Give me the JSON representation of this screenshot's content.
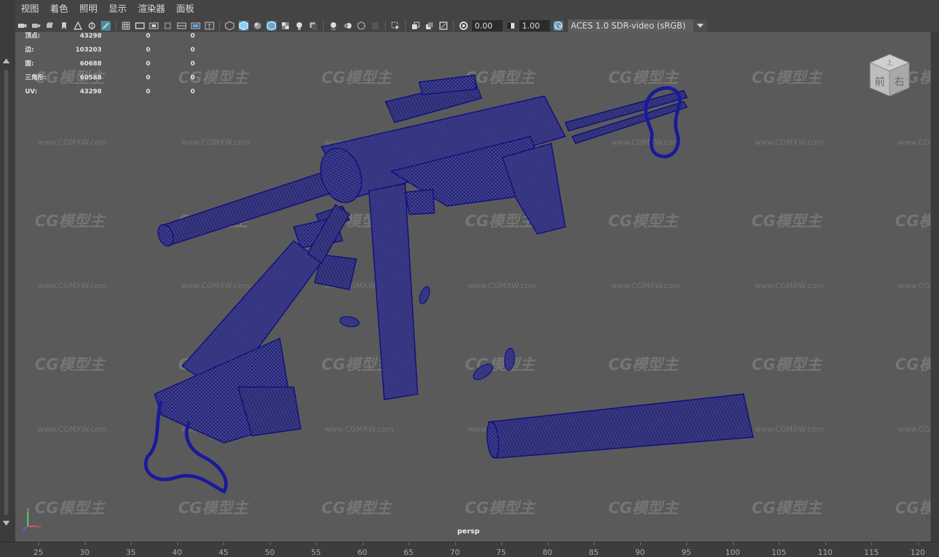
{
  "menu": {
    "items": [
      "视图",
      "着色",
      "照明",
      "显示",
      "渲染器",
      "面板"
    ]
  },
  "toolbar": {
    "field1_value": "0.00",
    "field2_value": "1.00",
    "color_space": "ACES 1.0 SDR-video (sRGB)"
  },
  "hud": {
    "rows": [
      {
        "label": "顶点:",
        "values": [
          "43298",
          "0",
          "0"
        ]
      },
      {
        "label": "边:",
        "values": [
          "103203",
          "0",
          "0"
        ]
      },
      {
        "label": "面:",
        "values": [
          "60688",
          "0",
          "0"
        ]
      },
      {
        "label": "三角形:",
        "values": [
          "60588",
          "0",
          "0"
        ]
      },
      {
        "label": "UV:",
        "values": [
          "43298",
          "0",
          "0"
        ]
      }
    ]
  },
  "viewport": {
    "camera": "persp",
    "viewcube_labels": [
      "上",
      "前",
      "右"
    ],
    "watermark_logo": "CG模型主",
    "watermark_url": "www.CGMXW.com",
    "wire_color": "#1a1a8c"
  },
  "timeline": {
    "ticks": [
      "25",
      "30",
      "35",
      "40",
      "45",
      "50",
      "55",
      "60",
      "65",
      "70",
      "75",
      "80",
      "85",
      "90",
      "95",
      "100",
      "105",
      "110",
      "115",
      "120"
    ]
  }
}
